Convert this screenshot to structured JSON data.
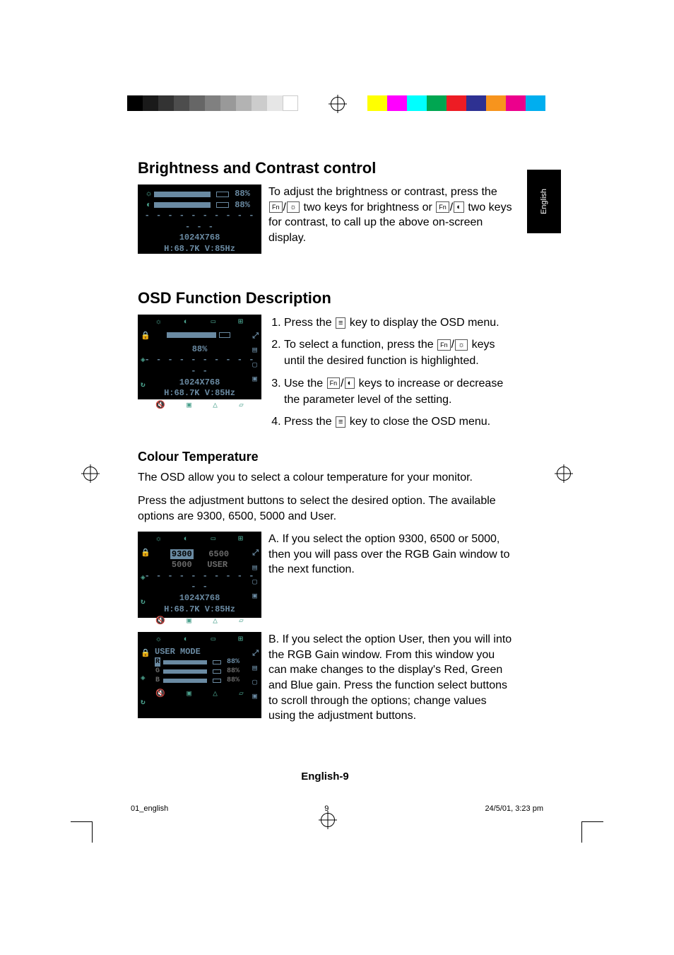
{
  "side_tab": "English",
  "section1": {
    "title": "Brightness and Contrast control",
    "osd": {
      "brightness_pct": "88%",
      "contrast_pct": "88%",
      "resolution": "1024X768",
      "sync": "H:68.7K V:85Hz"
    },
    "body_pre": "To adjust the brightness or contrast, press the ",
    "key_fn1": "Fn",
    "body_mid1": " two keys for brightness or ",
    "key_fn2": "Fn",
    "body_post": " two keys for contrast, to call up the above on-screen display."
  },
  "section2": {
    "title": "OSD Function Description",
    "osd": {
      "percent": "88%",
      "resolution": "1024X768",
      "sync": "H:68.7K V:85Hz"
    },
    "steps": {
      "s1a": "Press the ",
      "s1b": " key to display the OSD menu.",
      "s2a": "To select a function, press the ",
      "s2b": " keys until the desired function is highlighted.",
      "key_fn": "Fn",
      "s3a": "Use the ",
      "s3b": " keys to increase or decrease the parameter level of the setting.",
      "key_fn2": "Fn",
      "s4a": "Press the ",
      "s4b": " key to close the OSD menu."
    }
  },
  "colour_temp": {
    "heading": "Colour Temperature",
    "p1": "The OSD allow you to select a colour temperature for your monitor.",
    "p2": "Press the adjustment buttons to select the desired option. The available options are 9300, 6500, 5000 and User.",
    "osdA": {
      "opt_9300": "9300",
      "opt_6500": "6500",
      "opt_5000": "5000",
      "opt_user": "USER",
      "resolution": "1024X768",
      "sync": "H:68.7K V:85Hz"
    },
    "textA": "A. If you select the option 9300, 6500 or 5000, then you will pass over the RGB Gain window to the next function.",
    "osdB": {
      "mode": "USER MODE",
      "r": "R",
      "g": "G",
      "b": "B",
      "pct": "88%"
    },
    "textB": "B. If you select the option User, then you will into the RGB Gain window. From this window you can make changes to the display's Red, Green and Blue gain. Press the function select buttons to scroll through the options; change values using the adjustment buttons."
  },
  "footer": {
    "page_label": "English-9",
    "file": "01_english",
    "pagenum": "9",
    "timestamp": "24/5/01, 3:23 pm"
  }
}
